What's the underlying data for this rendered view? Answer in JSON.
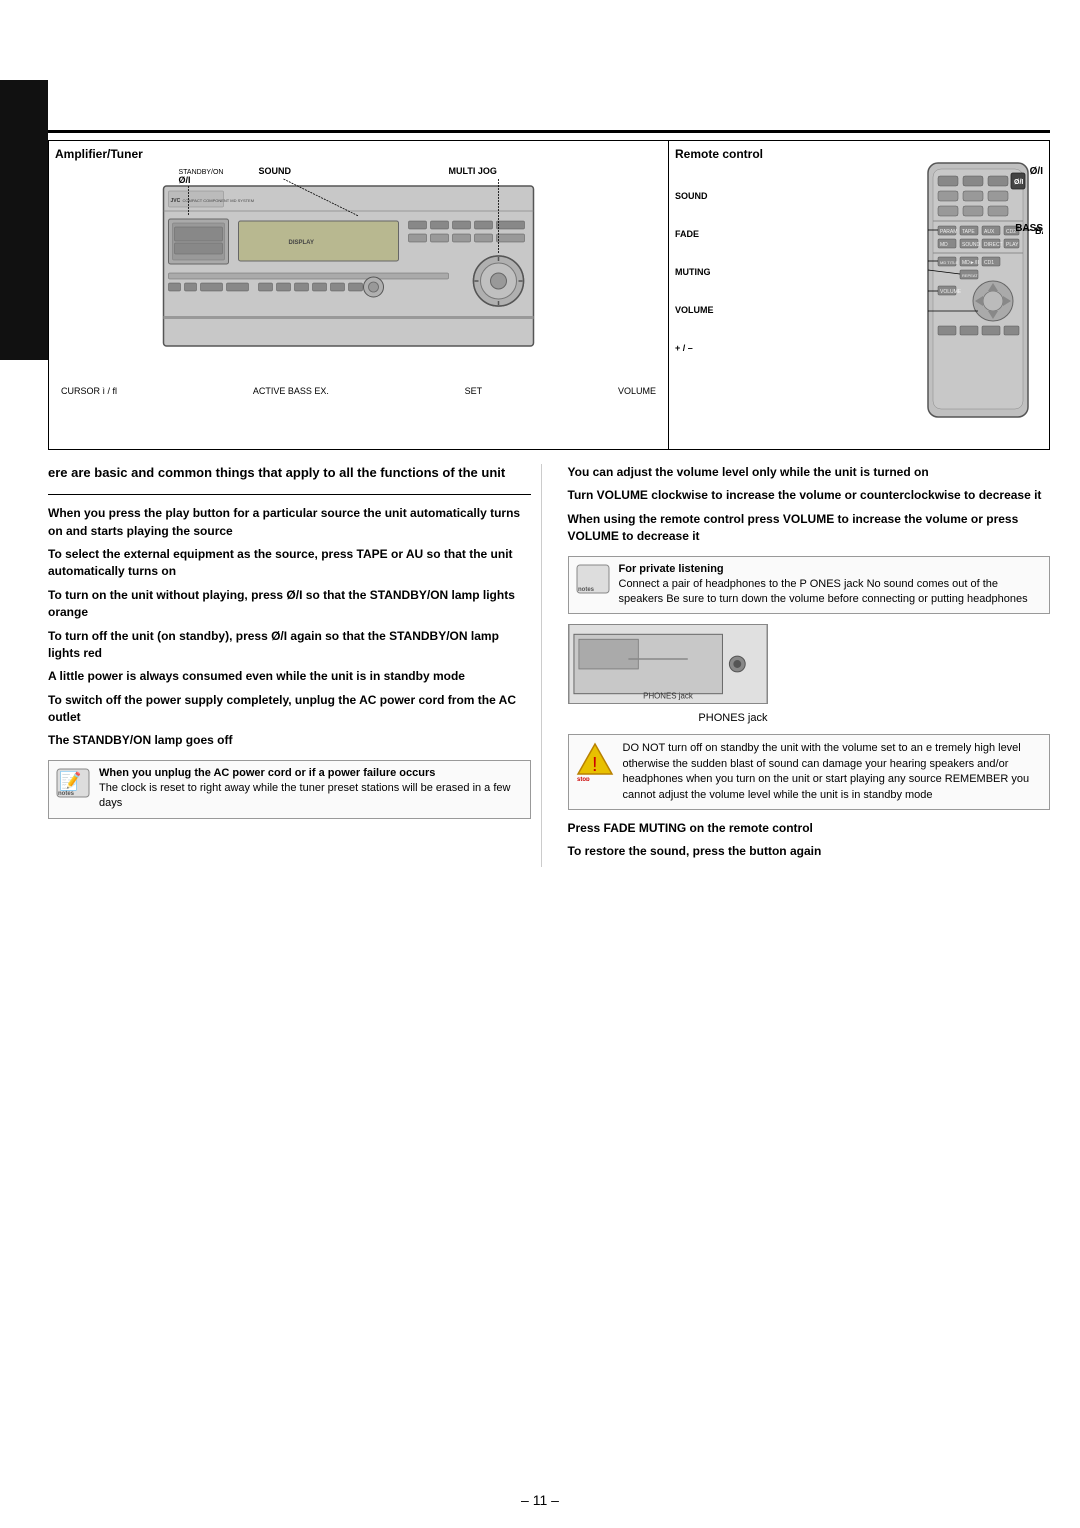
{
  "page": {
    "number": "– 11 –"
  },
  "diagram": {
    "amp_label": "Amplifier/Tuner",
    "remote_label": "Remote control",
    "amp_parts": {
      "power": "Ø/I",
      "standby": "STANDBY/ON",
      "sound": "SOUND",
      "multi_jog": "MULTI JOG",
      "cursor": "CURSOR ì    / fl",
      "active_bass": "ACTIVE BASS EX.",
      "set": "SET",
      "volume": "VOLUME"
    },
    "remote_parts": {
      "power": "Ø/I",
      "sound": "SOUND",
      "bass": "BASS",
      "fade": "FADE",
      "muting": "MUTING",
      "volume": "VOLUME",
      "plus_minus": "+ / –"
    }
  },
  "intro_text": "ere are basic and common things that apply to all the functions of the unit",
  "left_column": {
    "power_on_title": "When you press the play button for a particular source  the unit automatically turns on  and starts playing the source",
    "external_source_title": "To select the external equipment as the source, press TAPE or AU  so that the unit automatically turns on",
    "turn_on_no_play": "To turn on the unit without playing, press Ø/I so that the STANDBY/ON lamp lights orange",
    "turn_off_title": "To turn off the unit (on standby), press Ø/I again so that the STANDBY/ON lamp lights red",
    "little_power": "A little power is always consumed even while the unit is in standby mode",
    "switch_off_title": "To switch off the power supply completely, unplug the AC power cord from the AC outlet",
    "lamp_goes_off": "The STANDBY/ON lamp goes off",
    "notes_box": {
      "icon": "📝",
      "title": "When you unplug the AC power cord or if a power failure occurs",
      "text": "The clock is reset to      right away  while the tuner preset stations will be erased in a few days"
    }
  },
  "right_column": {
    "volume_title": "You can adjust the volume level only while the unit is turned on",
    "turn_volume_title": "Turn VOLUME clockwise to increase the volume or counterclockwise to decrease it",
    "remote_volume_title": "When using the remote control  press VOLUME   to increase the volume or press VOLUME   to decrease it",
    "notes_box": {
      "icon": "📝",
      "title": "For private listening",
      "text": "Connect a pair of headphones to the P  ONES jack  No sound comes out of the speakers  Be sure to turn down the volume before connecting or putting headphones"
    },
    "phones_label": "PHONES jack",
    "stop_box": {
      "icon": "⛔",
      "text": "DO NOT turn off  on standby  the unit with the volume set to an e tremely high level  otherwise the sudden blast of sound can damage your hearing speakers and/or headphones when you turn on the unit or start playing any source\nREMEMBER you cannot adjust the volume level while the unit is in standby mode"
    },
    "muting_title": "Press FADE MUTING on the remote control",
    "muting_restore": "To restore the sound, press the button again"
  }
}
